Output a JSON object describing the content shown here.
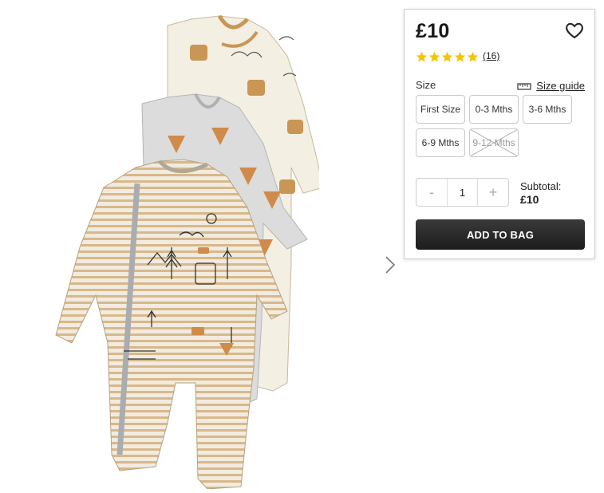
{
  "product": {
    "image_alt": "Three baby sleepsuits with woodland animal prints",
    "price": "£10",
    "rating": {
      "stars": 5,
      "review_count": "(16)"
    }
  },
  "size": {
    "label": "Size",
    "guide_label": "Size guide",
    "options": [
      {
        "label": "First Size",
        "available": true
      },
      {
        "label": "0-3 Mths",
        "available": true
      },
      {
        "label": "3-6 Mths",
        "available": true
      },
      {
        "label": "6-9 Mths",
        "available": true
      },
      {
        "label": "9-12 Mths",
        "available": false
      }
    ]
  },
  "quantity": {
    "minus": "-",
    "value": "1",
    "plus": "+"
  },
  "subtotal": {
    "label": "Subtotal:",
    "value": "£10"
  },
  "actions": {
    "add_to_bag": "ADD TO BAG"
  },
  "colors": {
    "star": "#f5c400",
    "button_dark": "#222222",
    "border": "#cfcfcf"
  }
}
